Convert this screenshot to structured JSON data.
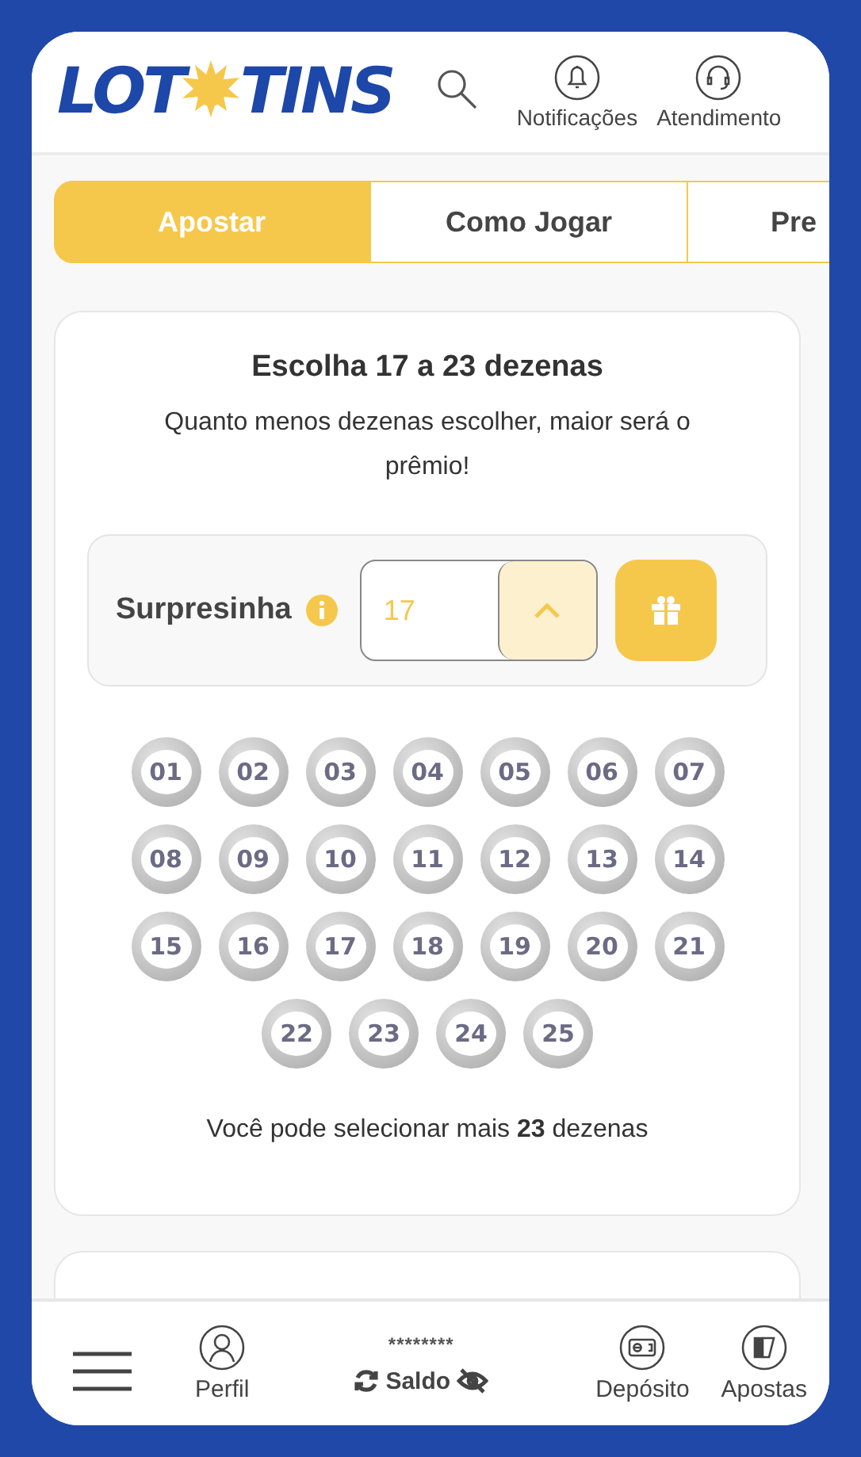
{
  "header": {
    "logo": {
      "left": "LOT",
      "right": "TINS"
    },
    "actions": [
      {
        "label": "Notificações",
        "kind": "bell"
      },
      {
        "label": "Atendimento",
        "kind": "headset"
      }
    ]
  },
  "tabs": [
    {
      "label": "Apostar",
      "selected": true
    },
    {
      "label": "Como Jogar",
      "selected": false
    },
    {
      "label": "Pre",
      "selected": false
    }
  ],
  "card": {
    "title": "Escolha 17 a 23 dezenas",
    "subtitle": "Quanto menos dezenas escolher, maior será o prêmio!",
    "surpresinha": {
      "label": "Surpresinha",
      "value": "17"
    },
    "numbers": [
      {
        "label": "01",
        "selected": false
      },
      {
        "label": "02",
        "selected": false
      },
      {
        "label": "03",
        "selected": false
      },
      {
        "label": "04",
        "selected": false
      },
      {
        "label": "05",
        "selected": false
      },
      {
        "label": "06",
        "selected": false
      },
      {
        "label": "07",
        "selected": false
      },
      {
        "label": "08",
        "selected": false
      },
      {
        "label": "09",
        "selected": false
      },
      {
        "label": "10",
        "selected": false
      },
      {
        "label": "11",
        "selected": false
      },
      {
        "label": "12",
        "selected": false
      },
      {
        "label": "13",
        "selected": false
      },
      {
        "label": "14",
        "selected": false
      },
      {
        "label": "15",
        "selected": false
      },
      {
        "label": "16",
        "selected": false
      },
      {
        "label": "17",
        "selected": false
      },
      {
        "label": "18",
        "selected": false
      },
      {
        "label": "19",
        "selected": false
      },
      {
        "label": "20",
        "selected": false
      },
      {
        "label": "21",
        "selected": false
      },
      {
        "label": "22",
        "selected": false
      },
      {
        "label": "23",
        "selected": false
      },
      {
        "label": "24",
        "selected": false
      },
      {
        "label": "25",
        "selected": false
      }
    ],
    "note": "Você pode selecionar mais **23** dezenas"
  },
  "bottom_nav": {
    "items": [
      {
        "kind": "menu"
      },
      {
        "kind": "profile",
        "label": "Perfil"
      },
      {
        "kind": "balance",
        "label": "Saldo",
        "value": "********"
      },
      {
        "kind": "deposit",
        "label": "Depósito"
      },
      {
        "kind": "bets",
        "label": "Apostas"
      }
    ]
  }
}
